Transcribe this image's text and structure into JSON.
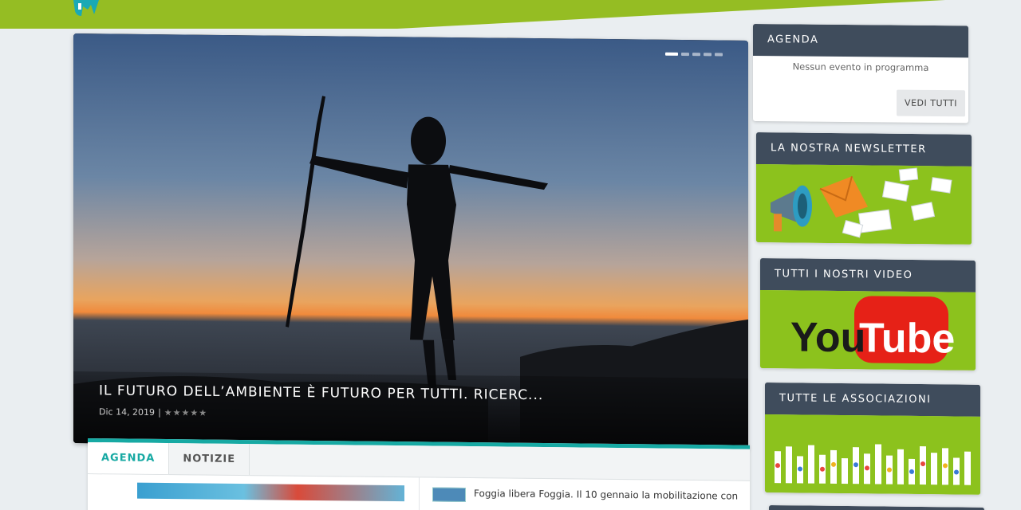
{
  "slider": {
    "title": "IL FUTURO DELL’AMBIENTE È FUTURO PER TUTTI. RICERC...",
    "date": "Dic 14, 2019",
    "separator": "|",
    "rating_stars": "★★★★★",
    "rating": 0,
    "slides_total": 5,
    "slide_active": 1
  },
  "tabs": [
    {
      "label": "AGENDA"
    },
    {
      "label": "NOTIZIE"
    }
  ],
  "news": {
    "item_title": "Foggia libera Foggia. Il 10 gennaio la mobilitazione con"
  },
  "widgets": {
    "agenda": {
      "title": "AGENDA",
      "empty_text": "Nessun evento in programma",
      "button": "VEDI TUTTI"
    },
    "newsletter": {
      "title": "LA NOSTRA NEWSLETTER"
    },
    "videos": {
      "title": "TUTTI I NOSTRI VIDEO",
      "logo_you": "You",
      "logo_tube": "Tube"
    },
    "associations": {
      "title": "TUTTE LE ASSOCIAZIONI"
    }
  },
  "colors": {
    "brand_green": "#95bd23",
    "teal_accent": "#17a9a3",
    "widget_header": "#3f4c5c",
    "banner_green": "#8cc21d",
    "youtube_red": "#e62117"
  }
}
